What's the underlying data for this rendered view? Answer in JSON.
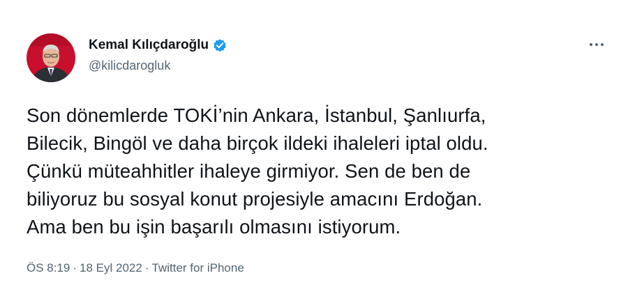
{
  "author": {
    "display_name": "Kemal Kılıçdaroğlu",
    "handle": "@kilicdarogluk",
    "verified_color": "#1d9bf0"
  },
  "tweet": {
    "lines": [
      "Son dönemlerde TOKİ’nin Ankara, İstanbul, Şanlıurfa,",
      "Bilecik, Bingöl ve daha birçok ildeki ihaleleri iptal oldu.",
      "Çünkü müteahhitler ihaleye girmiyor. Sen de ben de",
      "biliyoruz bu sosyal konut projesiyle amacını Erdoğan.",
      "Ama ben bu işin başarılı olmasını istiyorum."
    ]
  },
  "meta": {
    "time": "ÖS 8:19",
    "date": "18 Eyl 2022",
    "source": "Twitter for iPhone",
    "separator": "·"
  },
  "icons": {
    "more": "more-options-icon",
    "verified": "verified-badge-icon"
  }
}
